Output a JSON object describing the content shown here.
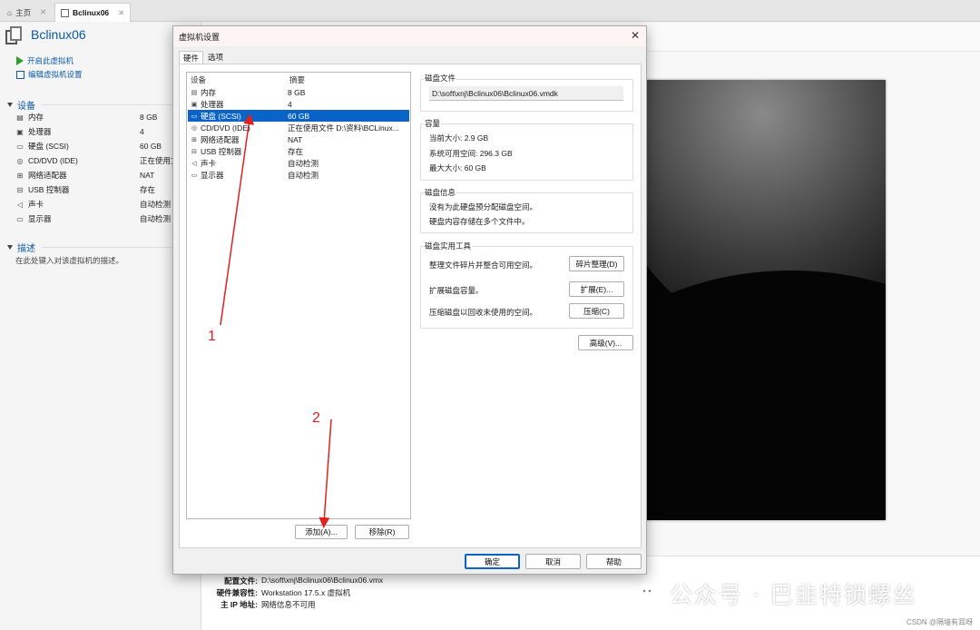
{
  "tabs": [
    {
      "label": "主页",
      "active": false
    },
    {
      "label": "Bclinux06",
      "active": true
    }
  ],
  "vm": {
    "title": "Bclinux06",
    "actions": [
      "开启此虚拟机",
      "编辑虚拟机设置"
    ]
  },
  "sidebar": {
    "devices_title": "设备",
    "devices": [
      {
        "icon": "memory-icon",
        "name": "内存",
        "value": "8 GB"
      },
      {
        "icon": "cpu-icon",
        "name": "处理器",
        "value": "4"
      },
      {
        "icon": "disk-icon",
        "name": "硬盘 (SCSI)",
        "value": "60 GB"
      },
      {
        "icon": "cd-icon",
        "name": "CD/DVD (IDE)",
        "value": "正在使用文件"
      },
      {
        "icon": "network-icon",
        "name": "网络适配器",
        "value": "NAT"
      },
      {
        "icon": "usb-icon",
        "name": "USB 控制器",
        "value": "存在"
      },
      {
        "icon": "speaker-icon",
        "name": "声卡",
        "value": "自动检测"
      },
      {
        "icon": "display-icon",
        "name": "显示器",
        "value": "自动检测"
      }
    ],
    "description_title": "描述",
    "description_placeholder": "在此处键入对该虚拟机的描述。"
  },
  "details": [
    {
      "key": "配置文件:",
      "value": "D:\\soft\\xnj\\Bclinux06\\Bclinux06.vmx"
    },
    {
      "key": "硬件兼容性:",
      "value": "Workstation 17.5.x 虚拟机"
    },
    {
      "key": "主 IP 地址:",
      "value": "网络信息不可用"
    }
  ],
  "dialog": {
    "title": "虚拟机设置",
    "tabs": [
      "硬件",
      "选项"
    ],
    "list_headers": {
      "device": "设备",
      "summary": "摘要"
    },
    "devices": [
      {
        "icon": "memory-icon",
        "name": "内存",
        "summary": "8 GB",
        "selected": false
      },
      {
        "icon": "cpu-icon",
        "name": "处理器",
        "summary": "4",
        "selected": false
      },
      {
        "icon": "disk-icon",
        "name": "硬盘 (SCSI)",
        "summary": "60 GB",
        "selected": true
      },
      {
        "icon": "cd-icon",
        "name": "CD/DVD (IDE)",
        "summary": "正在使用文件 D:\\资料\\BCLinux...",
        "selected": false
      },
      {
        "icon": "network-icon",
        "name": "网络适配器",
        "summary": "NAT",
        "selected": false
      },
      {
        "icon": "usb-icon",
        "name": "USB 控制器",
        "summary": "存在",
        "selected": false
      },
      {
        "icon": "speaker-icon",
        "name": "声卡",
        "summary": "自动检测",
        "selected": false
      },
      {
        "icon": "display-icon",
        "name": "显示器",
        "summary": "自动检测",
        "selected": false
      }
    ],
    "add_label": "添加(A)...",
    "remove_label": "移除(R)",
    "disk_file": {
      "title": "磁盘文件",
      "path": "D:\\soft\\xnj\\Bclinux06\\Bclinux06.vmdk"
    },
    "capacity": {
      "title": "容量",
      "current": "当前大小: 2.9 GB",
      "available": "系统可用空间: 296.3 GB",
      "max": "最大大小: 60 GB"
    },
    "disk_info": {
      "title": "磁盘信息",
      "line1": "没有为此硬盘预分配磁盘空间。",
      "line2": "硬盘内容存储在多个文件中。"
    },
    "utilities": {
      "title": "磁盘实用工具",
      "defrag_text": "整理文件碎片并整合可用空间。",
      "defrag_btn": "碎片整理(D)",
      "expand_text": "扩展磁盘容量。",
      "expand_btn": "扩展(E)...",
      "compact_text": "压缩磁盘以回收未使用的空间。",
      "compact_btn": "压缩(C)"
    },
    "advanced_btn": "高级(V)...",
    "ok": "确定",
    "cancel": "取消",
    "help": "帮助"
  },
  "annotations": {
    "one": "1",
    "two": "2",
    "color": "#e32020"
  },
  "watermark": {
    "text": "公众号 · 巴韭特锁螺丝",
    "csdn": "CSDN @隔墙有耳呀"
  }
}
